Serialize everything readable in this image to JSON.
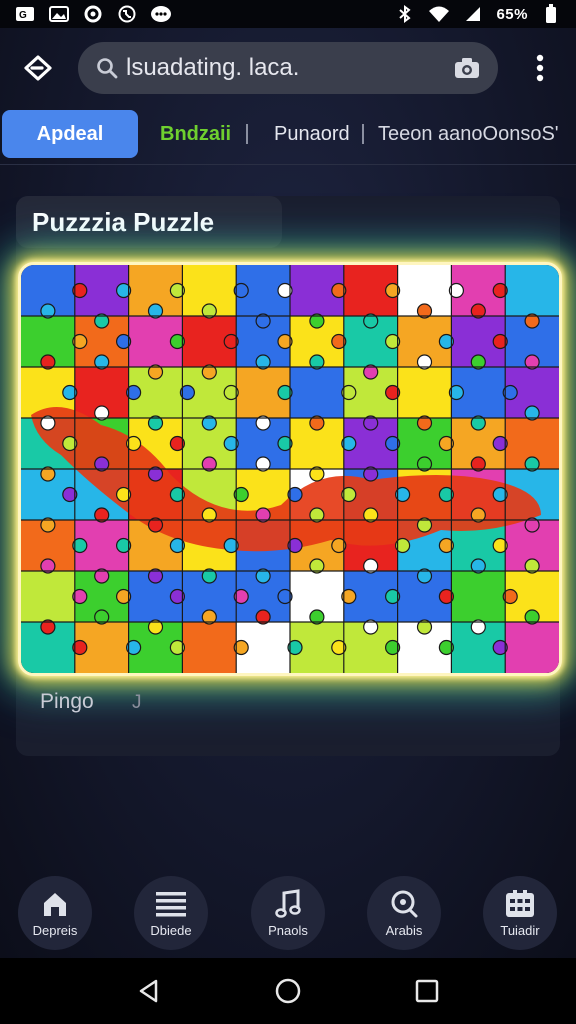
{
  "status_bar": {
    "left_icons": [
      "notification-icon",
      "image-icon",
      "sync-icon",
      "phone-icon",
      "messenger-icon"
    ],
    "right_icons": [
      "bluetooth-icon",
      "wifi-icon",
      "signal-icon",
      "battery-icon"
    ],
    "battery_text": "65%"
  },
  "search": {
    "value": "lsuadating. laca.",
    "icon": "search-icon",
    "camera_icon": "camera-icon"
  },
  "tabs": [
    {
      "label": "Apdeal",
      "active": true
    },
    {
      "label": "Bndzaii",
      "active": false
    },
    {
      "label": "Punaord",
      "active": false
    },
    {
      "label": "Teeon aanoOonsoS'",
      "active": false
    }
  ],
  "card": {
    "title": "Puzzzia Puzzle",
    "caption": "Pingo",
    "caption_cursor": "J"
  },
  "bottom_nav": [
    {
      "label": "Depreis",
      "icon": "home-icon"
    },
    {
      "label": "Dbiede",
      "icon": "list-icon"
    },
    {
      "label": "Pnaols",
      "icon": "music-note-icon"
    },
    {
      "label": "Arabis",
      "icon": "search-circle-icon"
    },
    {
      "label": "Tuiadir",
      "icon": "grid-icon"
    }
  ],
  "system_nav": [
    "back-triangle-icon",
    "home-circle-icon",
    "recents-square-icon"
  ],
  "colors": {
    "accent": "#4a86ec",
    "tab_green": "#6fd02f",
    "glow_yellow": "#ffd23c",
    "background": "#14182c"
  }
}
